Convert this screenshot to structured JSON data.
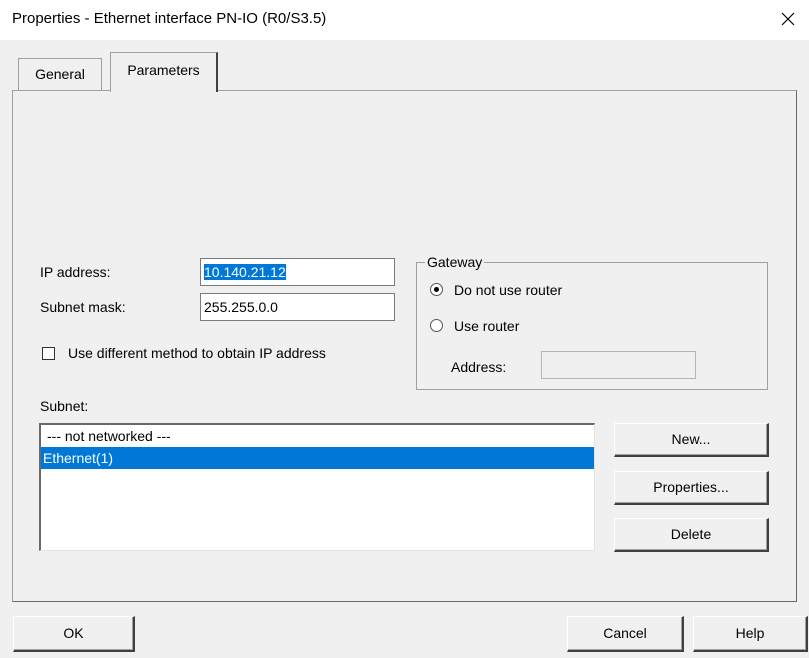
{
  "window": {
    "title": "Properties - Ethernet interface  PN-IO (R0/S3.5)",
    "close_glyph": "✕"
  },
  "tabs": [
    {
      "label": "General",
      "active": false
    },
    {
      "label": "Parameters",
      "active": true
    }
  ],
  "ip": {
    "ip_label": "IP address:",
    "ip_value": "10.140.21.12",
    "mask_label": "Subnet mask:",
    "mask_value": "255.255.0.0",
    "checkbox_label": "Use different method to obtain IP address",
    "checkbox_checked": false
  },
  "gateway": {
    "legend": "Gateway",
    "option_no_router": "Do not use router",
    "option_use_router": "Use router",
    "selected": "no_router",
    "address_label": "Address:",
    "address_value": ""
  },
  "subnet": {
    "label": "Subnet:",
    "items": [
      "--- not networked ---",
      "Ethernet(1)"
    ],
    "selected_index": 1,
    "new_button": "New...",
    "properties_button": "Properties...",
    "delete_button": "Delete"
  },
  "footer": {
    "ok_button": "OK",
    "cancel_button": "Cancel",
    "help_button": "Help"
  },
  "colors": {
    "selection": "#0078d7",
    "dialog_bg": "#f0f0f0"
  }
}
